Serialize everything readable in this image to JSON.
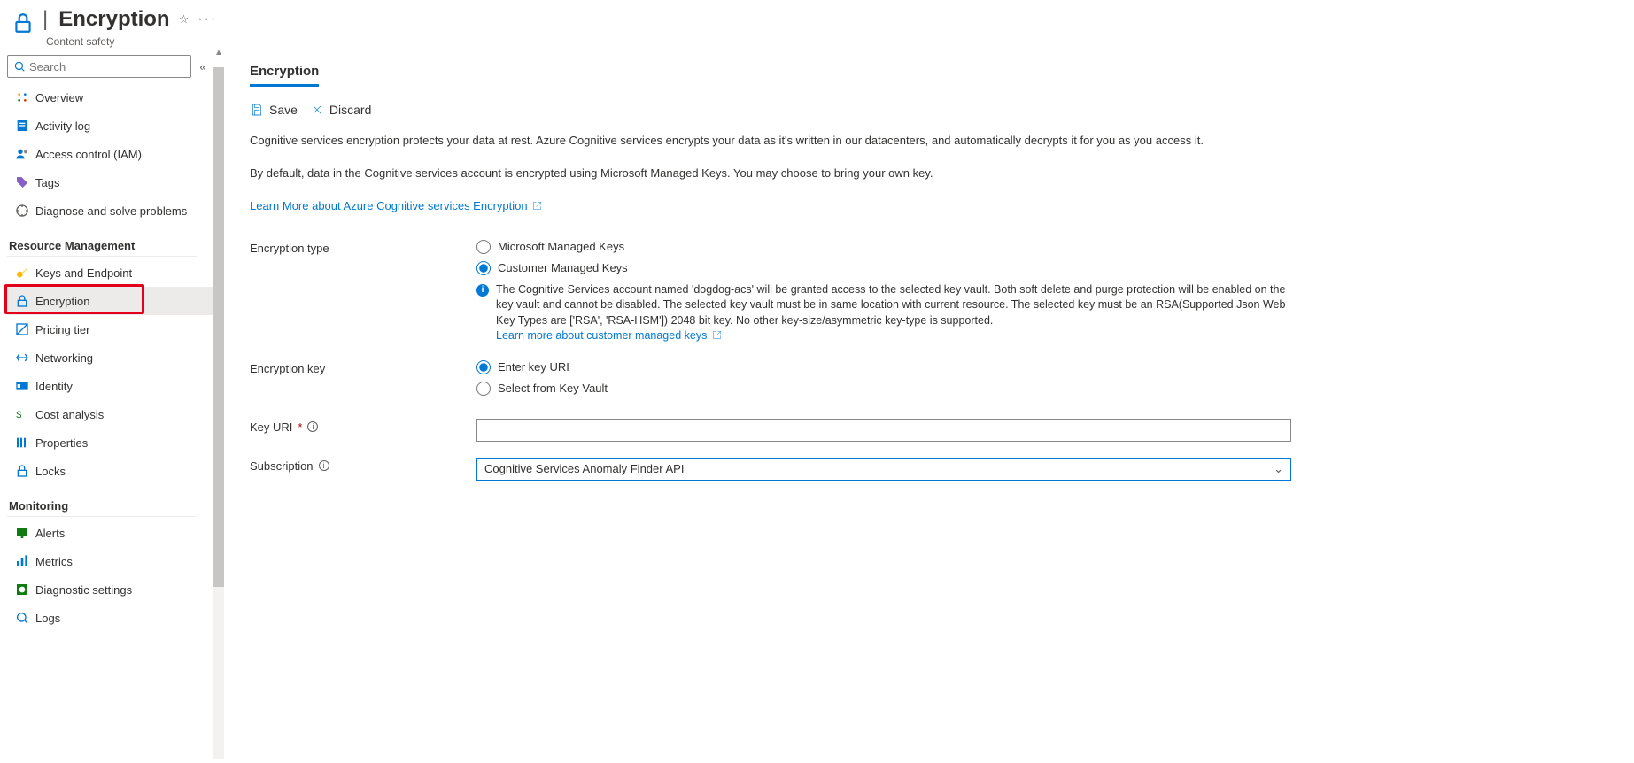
{
  "header": {
    "title": "Encryption",
    "subtitle": "Content safety"
  },
  "sidebar": {
    "search_placeholder": "Search",
    "items": [
      {
        "label": "Overview"
      },
      {
        "label": "Activity log"
      },
      {
        "label": "Access control (IAM)"
      },
      {
        "label": "Tags"
      },
      {
        "label": "Diagnose and solve problems"
      }
    ],
    "group_resource": "Resource Management",
    "resource_items": [
      {
        "label": "Keys and Endpoint"
      },
      {
        "label": "Encryption"
      },
      {
        "label": "Pricing tier"
      },
      {
        "label": "Networking"
      },
      {
        "label": "Identity"
      },
      {
        "label": "Cost analysis"
      },
      {
        "label": "Properties"
      },
      {
        "label": "Locks"
      }
    ],
    "group_monitoring": "Monitoring",
    "monitoring_items": [
      {
        "label": "Alerts"
      },
      {
        "label": "Metrics"
      },
      {
        "label": "Diagnostic settings"
      },
      {
        "label": "Logs"
      }
    ]
  },
  "content": {
    "tab": "Encryption",
    "save_label": "Save",
    "discard_label": "Discard",
    "para1": "Cognitive services encryption protects your data at rest. Azure Cognitive services encrypts your data as it's written in our datacenters, and automatically decrypts it for you as you access it.",
    "para2": "By default, data in the Cognitive services account is encrypted using Microsoft Managed Keys. You may choose to bring your own key.",
    "learn_more": "Learn More about Azure Cognitive services Encryption",
    "encryption_type_label": "Encryption type",
    "radio_mmk": "Microsoft Managed Keys",
    "radio_cmk": "Customer Managed Keys",
    "info_text": "The Cognitive Services account named 'dogdog-acs' will be granted access to the selected key vault. Both soft delete and purge protection will be enabled on the key vault and cannot be disabled. The selected key vault must be in same location with current resource. The selected key must be an RSA(Supported Json Web Key Types are ['RSA', 'RSA-HSM']) 2048 bit key. No other key-size/asymmetric key-type is supported.",
    "info_link": "Learn more about customer managed keys",
    "encryption_key_label": "Encryption key",
    "radio_enter_uri": "Enter key URI",
    "radio_select_vault": "Select from Key Vault",
    "key_uri_label": "Key URI",
    "subscription_label": "Subscription",
    "subscription_value": "Cognitive Services Anomaly Finder API"
  }
}
